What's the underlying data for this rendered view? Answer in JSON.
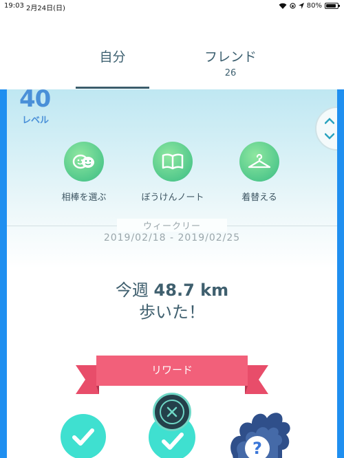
{
  "status_bar": {
    "time": "19:03",
    "date": "2月24日(日)",
    "battery": "80%"
  },
  "tabs": {
    "self_label": "自分",
    "friends_label": "フレンド",
    "friends_count": "26"
  },
  "level": {
    "number": "40",
    "label": "レベル"
  },
  "actions": [
    {
      "label": "相棒を選ぶ",
      "icon": "buddy-icon"
    },
    {
      "label": "ぼうけんノート",
      "icon": "journal-book-icon"
    },
    {
      "label": "着替える",
      "icon": "hanger-icon"
    }
  ],
  "weekly": {
    "title": "ウィークリー",
    "date_range": "2019/02/18 - 2019/02/25",
    "walked_prefix": "今週",
    "walked_distance": "48.7 km",
    "walked_suffix": "歩いた！"
  },
  "reward": {
    "label": "リワード"
  },
  "colors": {
    "accent_blue": "#1f8ff0",
    "level_blue": "#4a90d8",
    "action_green": "#53c98c",
    "ribbon_pink": "#f2607a",
    "check_teal": "#3fe0d0",
    "text_dark": "#3f5f6e"
  }
}
